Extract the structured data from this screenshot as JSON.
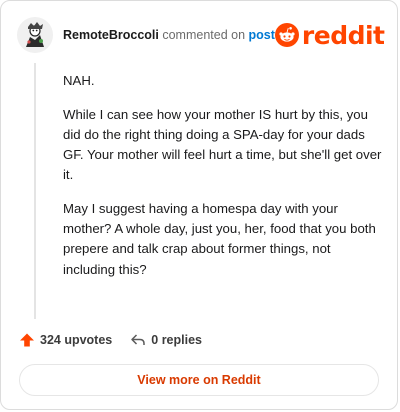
{
  "comment": {
    "username": "RemoteBroccoli",
    "action_text": "commented on",
    "post_link_label": "post",
    "paragraphs": [
      "NAH.",
      "While I can see how your mother IS hurt by this, you did do the right thing doing a SPA-day for your dads GF. Your mother will feel hurt a time, but she'll get over it.",
      "May I suggest having a homespa day with your mother? A whole day, just you, her, food that you both prepere and talk crap about former things, not including this?"
    ]
  },
  "brand": {
    "name": "reddit",
    "color": "#ff4500",
    "icon": "reddit-alien-icon"
  },
  "stats": {
    "upvotes": "324 upvotes",
    "replies": "0 replies"
  },
  "actions": {
    "view_more": "View more on Reddit"
  }
}
